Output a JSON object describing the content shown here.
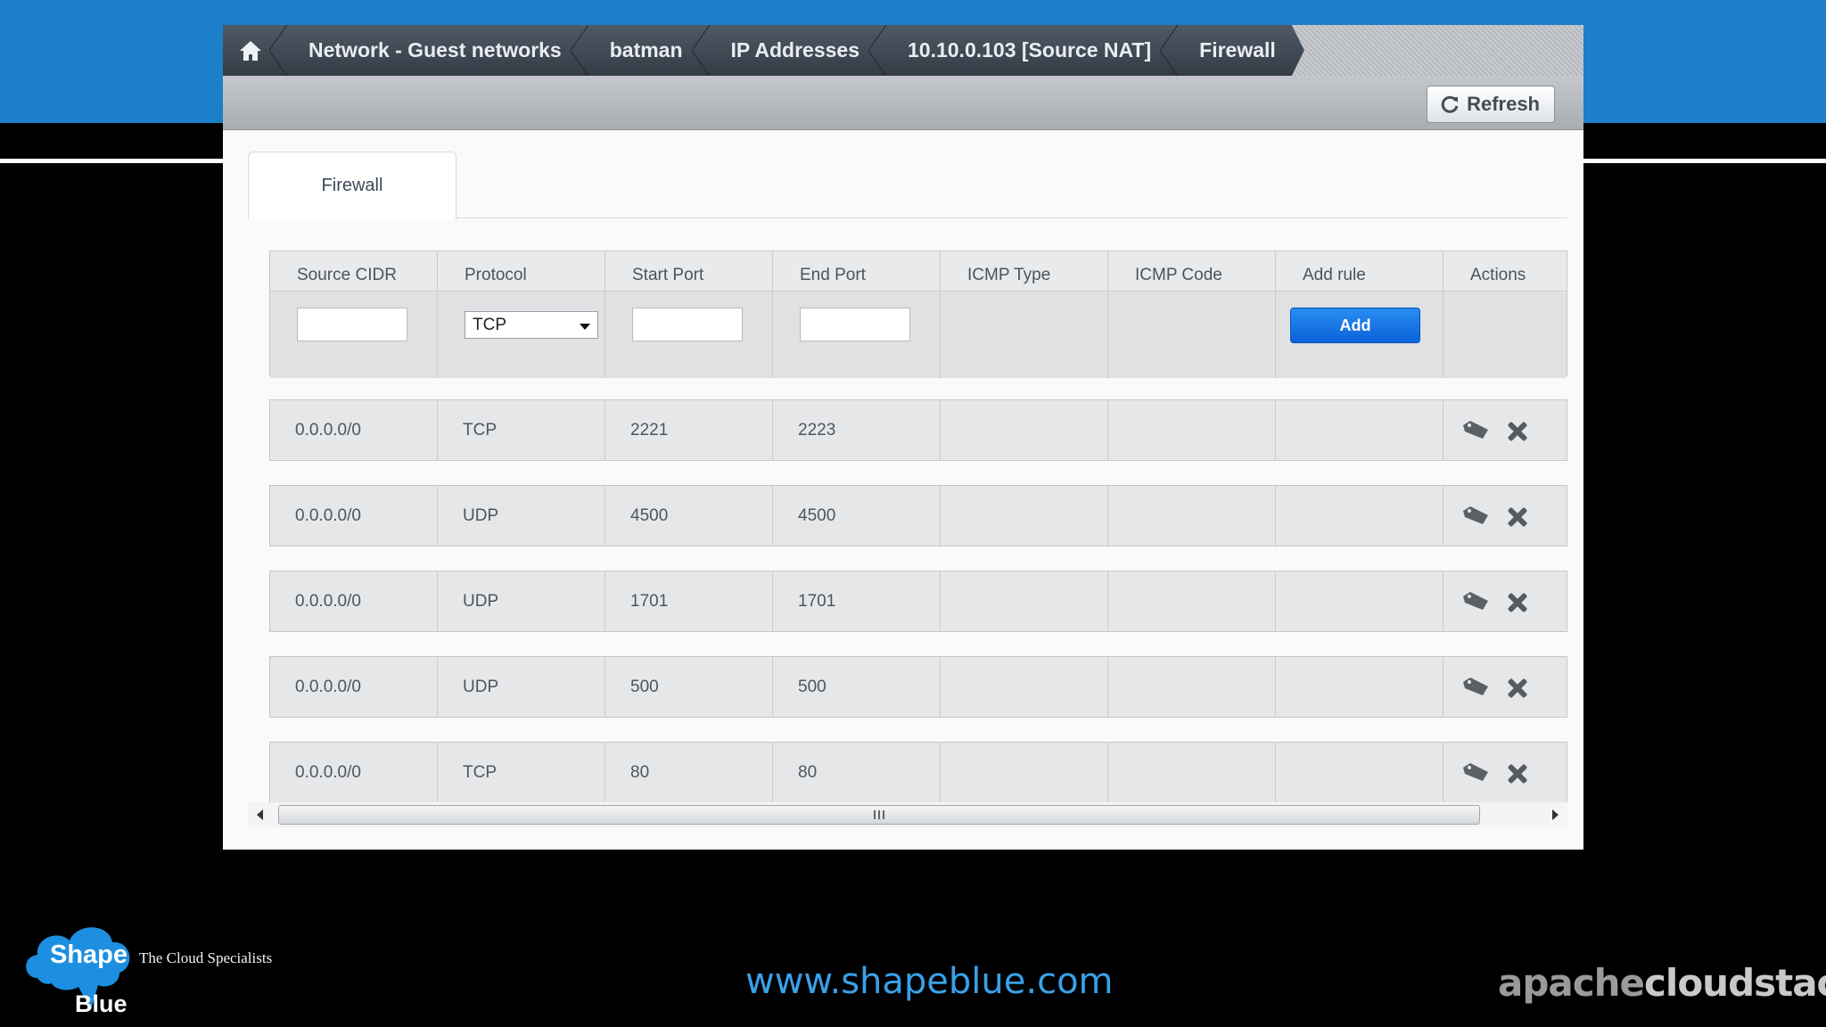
{
  "breadcrumb": {
    "items": [
      "Network - Guest networks",
      "batman",
      "IP Addresses",
      "10.10.0.103 [Source NAT]",
      "Firewall"
    ]
  },
  "toolbar": {
    "refresh_label": "Refresh"
  },
  "tabs": [
    {
      "label": "Firewall"
    }
  ],
  "table": {
    "headers": [
      "Source CIDR",
      "Protocol",
      "Start Port",
      "End Port",
      "ICMP Type",
      "ICMP Code",
      "Add rule",
      "Actions"
    ],
    "new_rule": {
      "protocol": "TCP",
      "add_label": "Add"
    },
    "rows": [
      {
        "cidr": "0.0.0.0/0",
        "protocol": "TCP",
        "start": "2221",
        "end": "2223"
      },
      {
        "cidr": "0.0.0.0/0",
        "protocol": "UDP",
        "start": "4500",
        "end": "4500"
      },
      {
        "cidr": "0.0.0.0/0",
        "protocol": "UDP",
        "start": "1701",
        "end": "1701"
      },
      {
        "cidr": "0.0.0.0/0",
        "protocol": "UDP",
        "start": "500",
        "end": "500"
      },
      {
        "cidr": "0.0.0.0/0",
        "protocol": "TCP",
        "start": "80",
        "end": "80"
      }
    ]
  },
  "footer": {
    "logo_word1": "Shape",
    "logo_word2": "Blue",
    "tagline": "The Cloud Specialists",
    "website": "www.shapeblue.com",
    "brand_part1": "apache",
    "brand_part2": "cloudstack"
  },
  "colors": {
    "top_band": "#1b7fc9",
    "add_button": "#0a62d8",
    "website": "#3aa0e8"
  }
}
